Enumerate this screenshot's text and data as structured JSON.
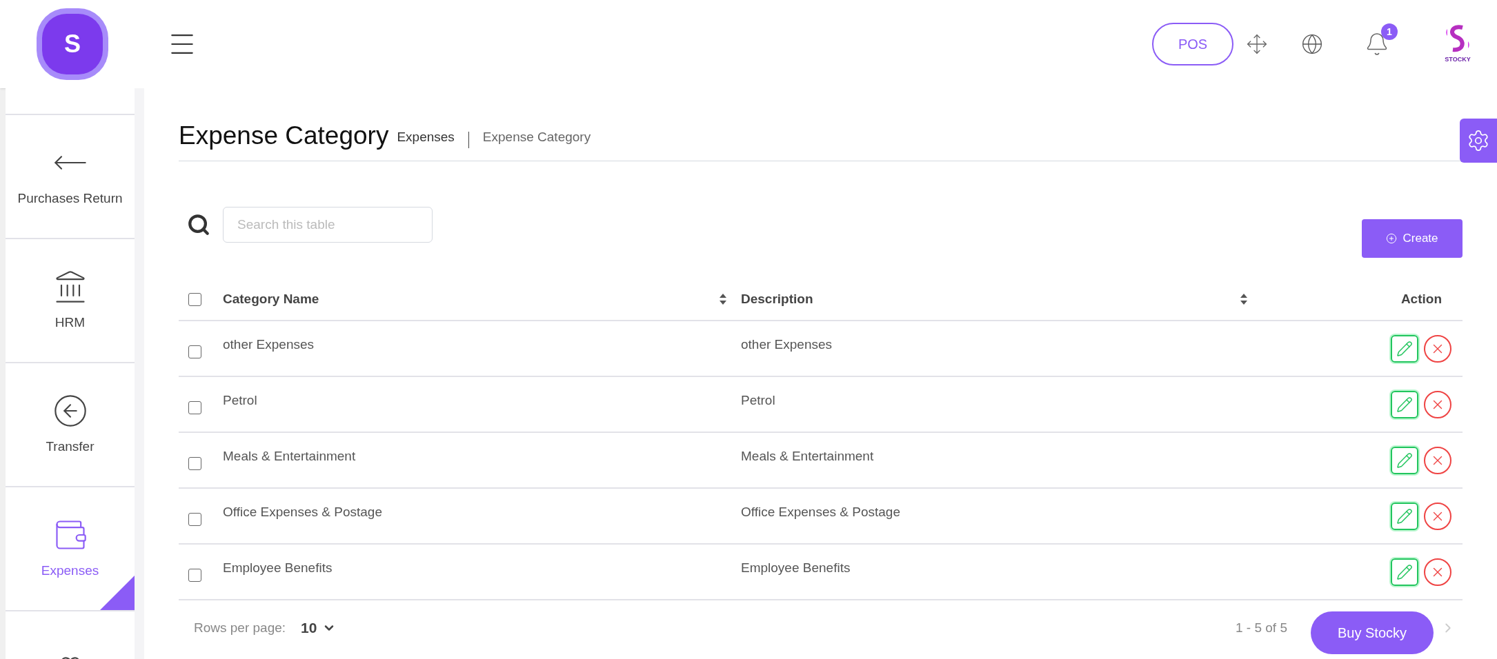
{
  "topbar": {
    "logo_letter": "S",
    "pos_button": "POS",
    "notification_count": "1",
    "brand_caption": "STOCKY"
  },
  "sidebar": {
    "items": [
      {
        "label": "Purchases Return",
        "selected": false
      },
      {
        "label": "HRM",
        "selected": false
      },
      {
        "label": "Transfer",
        "selected": false
      },
      {
        "label": "Expenses",
        "selected": true
      },
      {
        "selected": false
      }
    ]
  },
  "page": {
    "title": "Expense Category",
    "breadcrumb": [
      "Expenses",
      "Expense Category"
    ]
  },
  "search": {
    "placeholder": "Search this table"
  },
  "create_button": "Create",
  "table": {
    "select_all": {
      "checked": false
    },
    "columns": [
      "Category Name",
      "Description",
      "Action"
    ],
    "rows": [
      {
        "checked": false,
        "name": "other Expenses",
        "description": "other Expenses"
      },
      {
        "checked": false,
        "name": "Petrol",
        "description": "Petrol"
      },
      {
        "checked": false,
        "name": "Meals & Entertainment",
        "description": "Meals & Entertainment"
      },
      {
        "checked": false,
        "name": "Office Expenses & Postage",
        "description": "Office Expenses & Postage"
      },
      {
        "checked": false,
        "name": "Employee Benefits",
        "description": "Employee Benefits"
      }
    ]
  },
  "footer": {
    "rows_per_page_label": "Rows per page:",
    "rows_per_page": "10",
    "range": "1 - 5 of 5"
  },
  "buy_button": "Buy Stocky"
}
